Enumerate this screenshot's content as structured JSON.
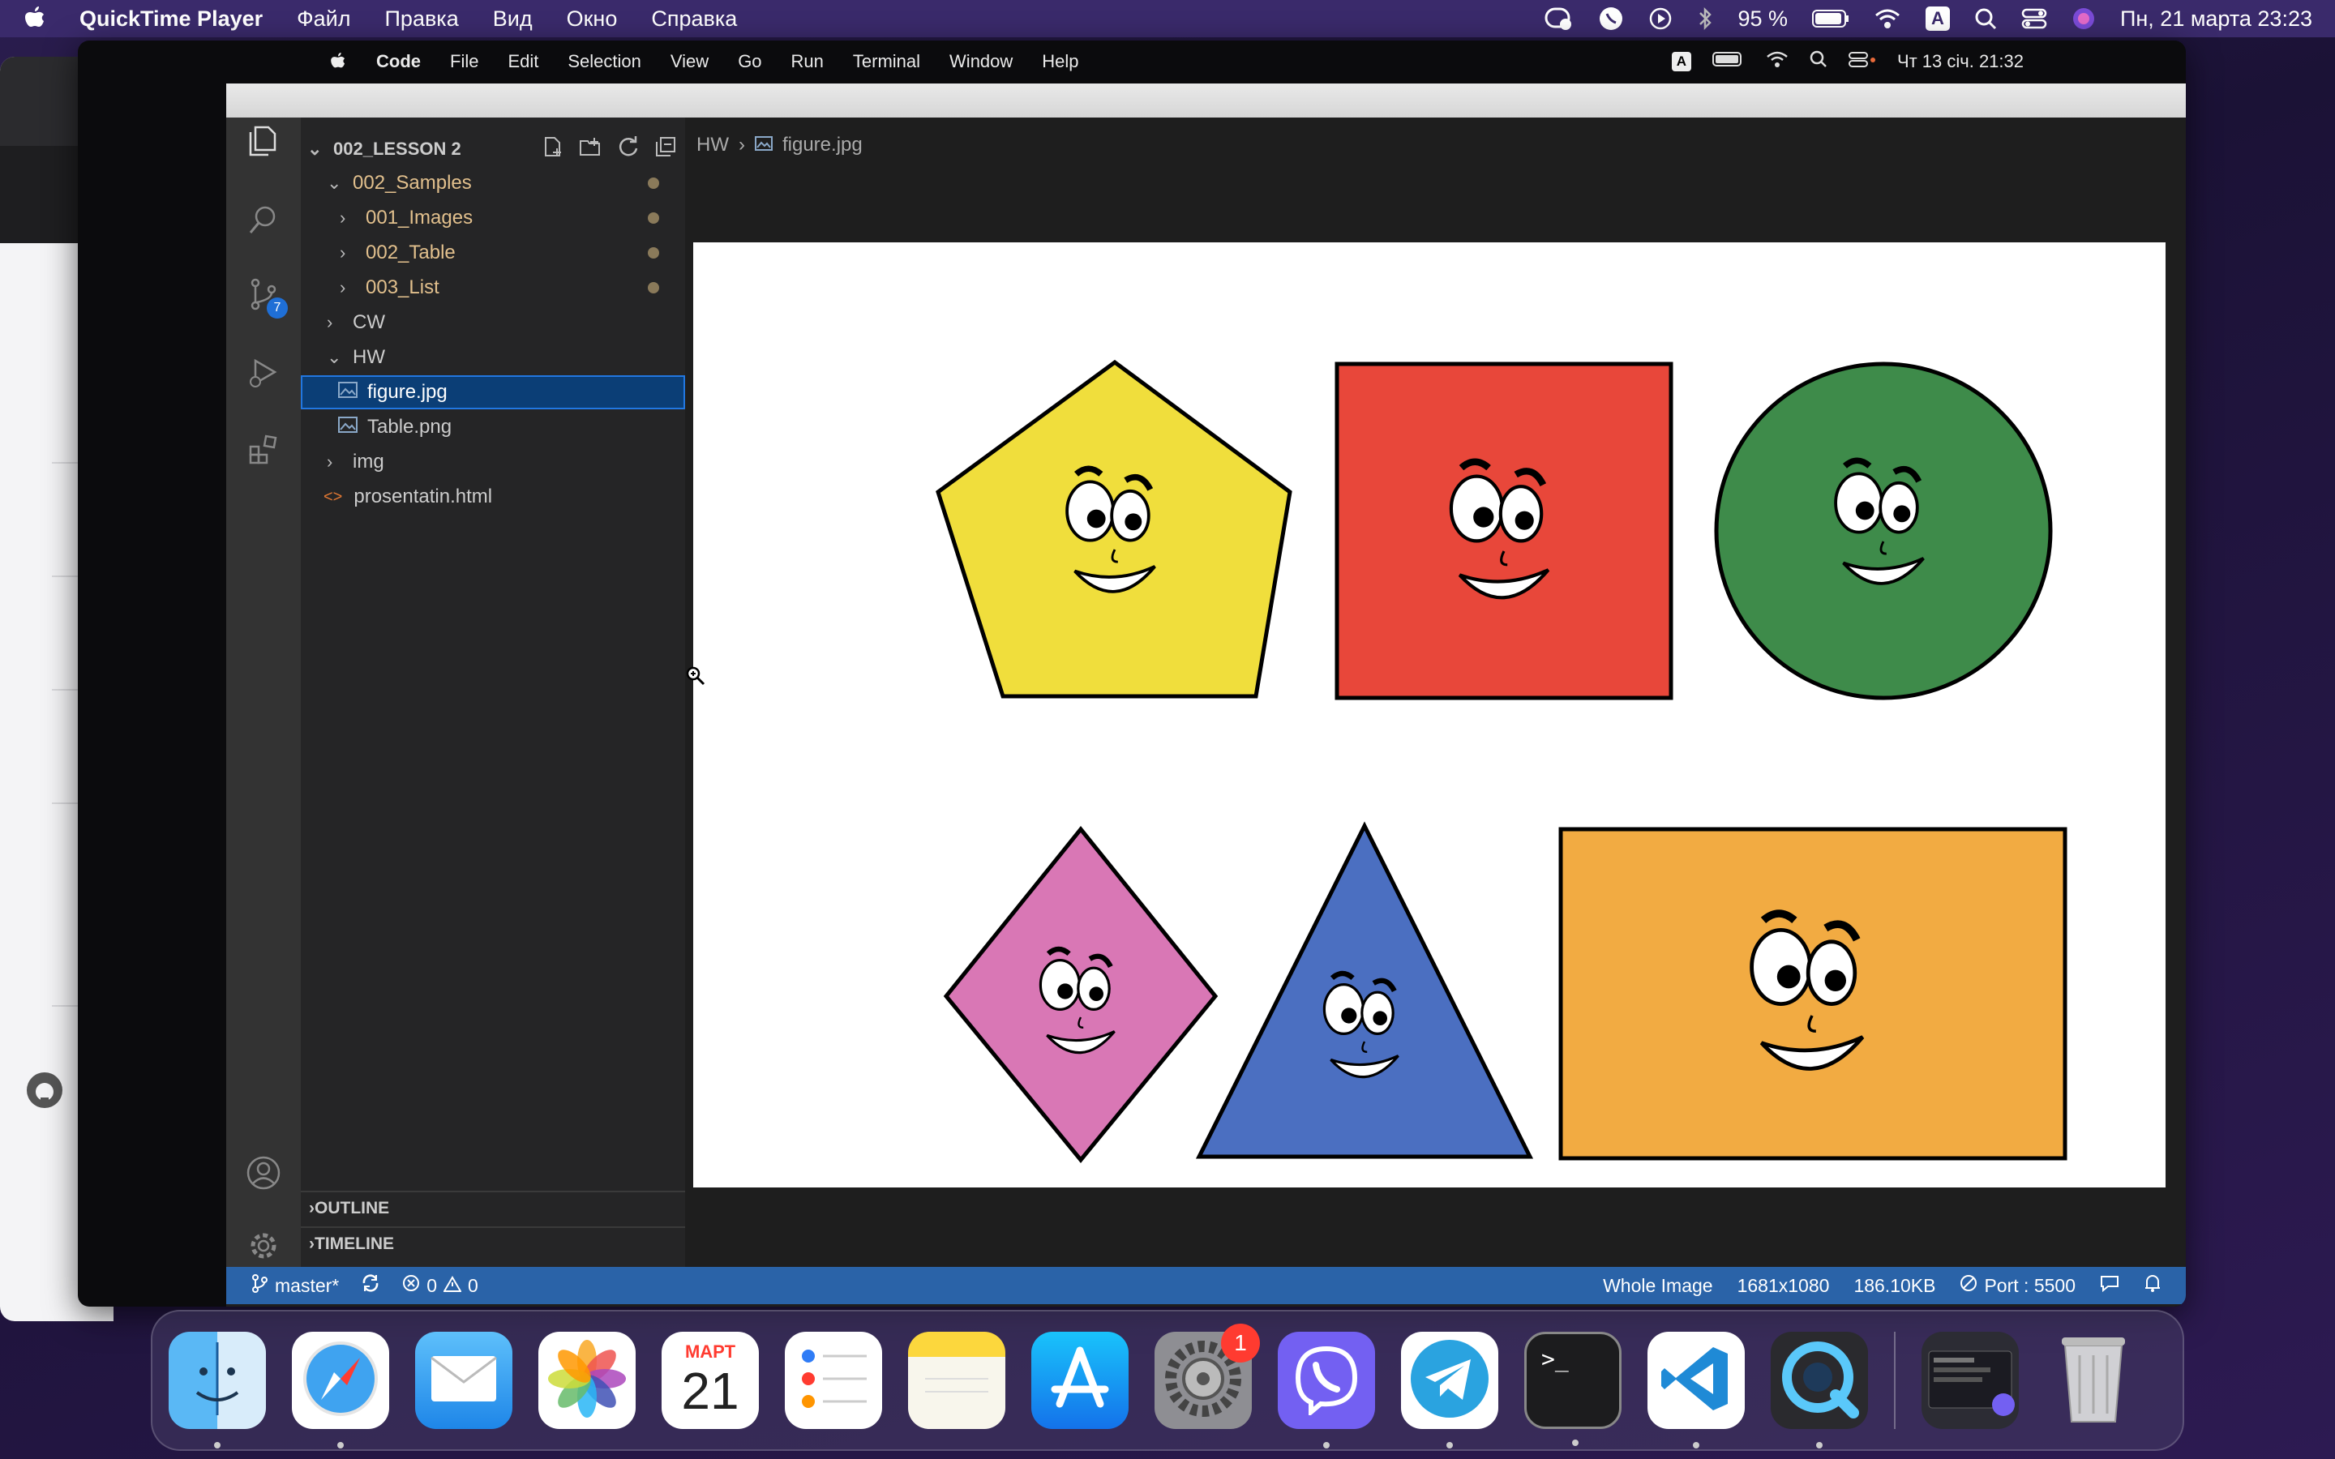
{
  "mac_menubar": {
    "app_name": "QuickTime Player",
    "menus": [
      "Файл",
      "Правка",
      "Вид",
      "Окно",
      "Справка"
    ],
    "battery": "95 %",
    "input_source": "A",
    "datetime": "Пн, 21 марта  23:23"
  },
  "inner_menubar": {
    "app_name": "Code",
    "menus": [
      "File",
      "Edit",
      "Selection",
      "View",
      "Go",
      "Run",
      "Terminal",
      "Window",
      "Help"
    ],
    "input_source": "A",
    "datetime": "Чт 13 січ.  21:32"
  },
  "activity_bar": {
    "source_control_badge": "7"
  },
  "explorer": {
    "root": "002_LESSON 2",
    "items": [
      {
        "label": "002_Samples",
        "kind": "folder-open"
      },
      {
        "label": "001_Images",
        "kind": "folder"
      },
      {
        "label": "002_Table",
        "kind": "folder"
      },
      {
        "label": "003_List",
        "kind": "folder"
      },
      {
        "label": "CW",
        "kind": "folder"
      },
      {
        "label": "HW",
        "kind": "folder-open"
      },
      {
        "label": "figure.jpg",
        "kind": "image"
      },
      {
        "label": "Table.png",
        "kind": "image"
      },
      {
        "label": "img",
        "kind": "folder"
      },
      {
        "label": "prosentatin.html",
        "kind": "html"
      }
    ],
    "outline": "OUTLINE",
    "timeline": "TIMELINE"
  },
  "editor": {
    "breadcrumb": [
      "HW",
      "figure.jpg"
    ],
    "image_shapes": [
      "pentagon",
      "square",
      "circle",
      "diamond",
      "triangle",
      "rectangle"
    ],
    "colors": {
      "pentagon": "#f0de3c",
      "square": "#e8473a",
      "circle": "#3e8b4a",
      "diamond": "#d977b5",
      "triangle": "#4b6fc1",
      "rectangle": "#f2ab42"
    }
  },
  "statusbar": {
    "branch": "master*",
    "errors": "0",
    "warnings": "0",
    "image_view": "Whole Image",
    "dimensions": "1681x1080",
    "size": "186.10KB",
    "port": "Port : 5500"
  },
  "dock": {
    "items": [
      "finder",
      "safari",
      "mail",
      "photos",
      "calendar",
      "reminders",
      "notes",
      "app-store",
      "system-preferences",
      "viber",
      "telegram",
      "terminal",
      "vscode",
      "quicktime"
    ],
    "calendar_month": "МАРТ",
    "calendar_day": "21",
    "system_preferences_badge": "1"
  }
}
